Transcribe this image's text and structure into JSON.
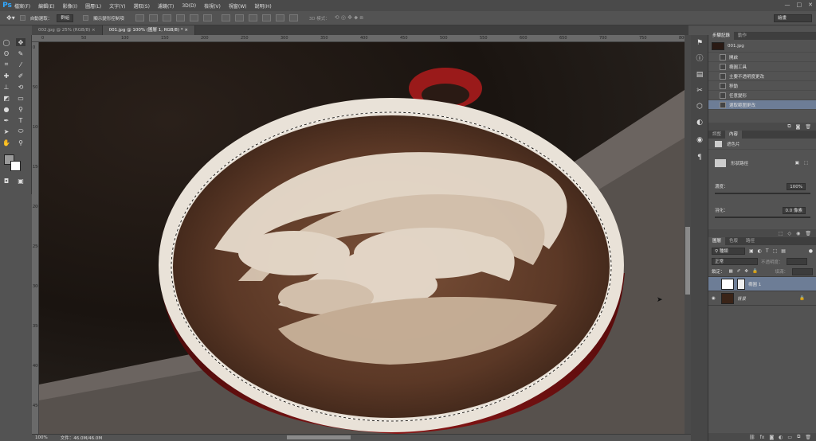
{
  "app": {
    "logo": "Ps"
  },
  "menu": [
    "檔案(F)",
    "編輯(E)",
    "影像(I)",
    "圖層(L)",
    "文字(Y)",
    "選取(S)",
    "濾鏡(T)",
    "3D(D)",
    "檢視(V)",
    "視窗(W)",
    "說明(H)"
  ],
  "window_controls": [
    "—",
    "□",
    "✕"
  ],
  "options": {
    "auto_select_label": "自動選取：",
    "auto_select_value": "群組",
    "show_transform_label": "顯示變形控制項",
    "mode3d_label": "3D 模式："
  },
  "workspace": "繪畫",
  "tabs": [
    {
      "label": "002.jpg @ 25% (RGB/8)",
      "close": "×"
    },
    {
      "label": "001.jpg @ 100% (圖層 1, RGB/8) *",
      "close": "×"
    }
  ],
  "ruler_labels": [
    "0",
    "50",
    "100",
    "150",
    "200",
    "250",
    "300",
    "350",
    "400",
    "450",
    "500",
    "550",
    "600",
    "650",
    "700",
    "750",
    "800"
  ],
  "status": {
    "zoom": "100%",
    "doc": "文件：46.0M/46.0M"
  },
  "history": {
    "tabs": [
      "步驟記錄",
      "動作"
    ],
    "snapshot": "001.jpg",
    "items": [
      "開啟",
      "橢圓工具",
      "主要不透明度更改",
      "移動",
      "任意變形",
      "選取範圍更改"
    ]
  },
  "properties": {
    "tabs": [
      "調整",
      "內容"
    ],
    "type": "遮色片",
    "mask_label": "形狀路徑",
    "density_label": "濃度：",
    "density_value": "100%",
    "feather_label": "羽化：",
    "feather_value": "0.0 像素"
  },
  "layers": {
    "tabs": [
      "圖層",
      "色版",
      "路徑"
    ],
    "filter": "種類",
    "blend": "正常",
    "opacity_label": "不透明度：",
    "opacity_value": "",
    "lock_label": "鎖定：",
    "fill_label": "填滿：",
    "fill_value": "",
    "items": [
      {
        "name": "橢圓 1"
      },
      {
        "name": "背景"
      }
    ]
  },
  "colors": {
    "accent": "#6d7d96",
    "logo": "#31a8ff"
  }
}
